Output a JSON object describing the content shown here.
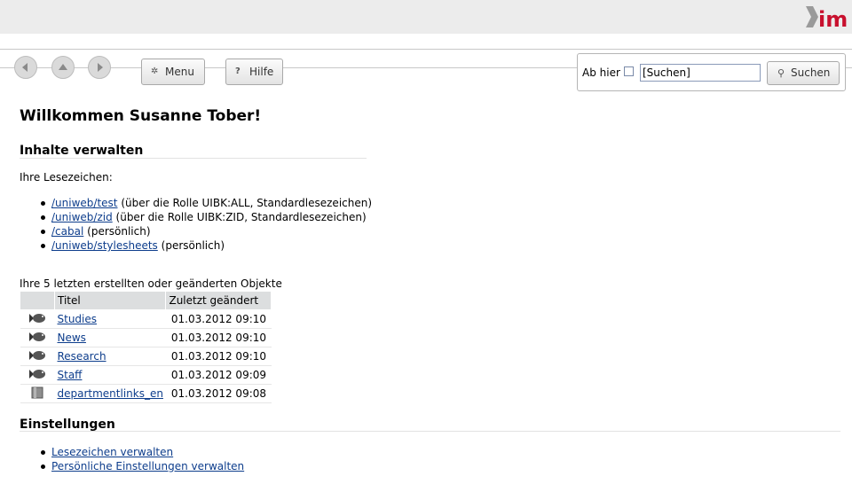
{
  "app": {
    "logo_text": "ims"
  },
  "toolbar": {
    "menu_label": "Menu",
    "help_label": "Hilfe",
    "menu_icon": "gear-icon",
    "help_icon": "question-icon"
  },
  "search": {
    "scope_label": "Ab hier",
    "value": "[Suchen]",
    "button_label": "Suchen"
  },
  "main": {
    "greeting": "Willkommen Susanne Tober!",
    "content_heading": "Inhalte verwalten",
    "bookmarks_intro": "Ihre Lesezeichen:",
    "bookmarks": [
      {
        "link": "/uniweb/test",
        "note": "(über die Rolle UIBK:ALL, Standardlesezeichen)"
      },
      {
        "link": "/uniweb/zid",
        "note": "(über die Rolle UIBK:ZID, Standardlesezeichen)"
      },
      {
        "link": "/cabal",
        "note": "(persönlich)"
      },
      {
        "link": "/uniweb/stylesheets",
        "note": "(persönlich)"
      }
    ],
    "recent_caption": "Ihre 5 letzten erstellten oder geänderten Objekte",
    "recent_columns": [
      "Titel",
      "Zuletzt geändert"
    ],
    "recent_rows": [
      {
        "icon": "fish-icon",
        "title": "Studies",
        "date": "01.03.2012 09:10"
      },
      {
        "icon": "fish-icon",
        "title": "News",
        "date": "01.03.2012 09:10"
      },
      {
        "icon": "fish-icon",
        "title": "Research",
        "date": "01.03.2012 09:10"
      },
      {
        "icon": "fish-icon",
        "title": "Staff",
        "date": "01.03.2012 09:09"
      },
      {
        "icon": "folder-icon",
        "title": "departmentlinks_en",
        "date": "01.03.2012 09:08"
      }
    ],
    "settings_heading": "Einstellungen",
    "settings_links": [
      "Lesezeichen verwalten",
      "Persönliche Einstellungen verwalten"
    ]
  }
}
